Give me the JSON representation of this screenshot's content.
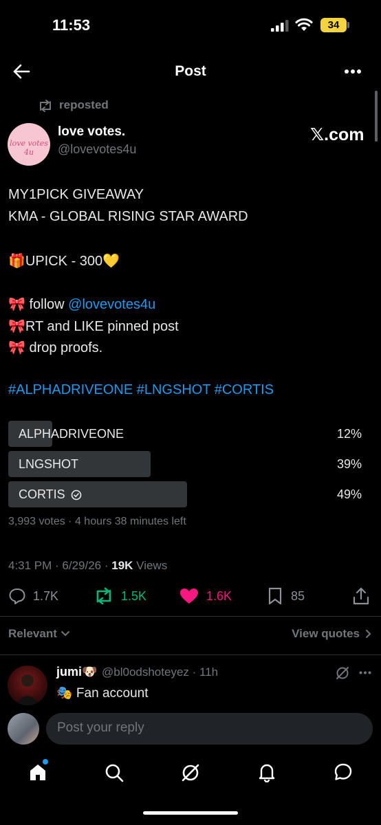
{
  "status_bar": {
    "time": "11:53",
    "battery": "34"
  },
  "header": {
    "title": "Post",
    "back_icon": "back-arrow-icon",
    "more_icon": "more-horizontal-icon"
  },
  "repost": {
    "label": "reposted"
  },
  "post": {
    "display_name": "love votes.",
    "handle": "@lovevotes4u",
    "avatar_text": "love votes 4u",
    "source_badge": "𝕏.com",
    "lines": {
      "l1": "MY1PICK GIVEAWAY",
      "l2": "KMA - GLOBAL RISING STAR AWARD",
      "l3": "🎁UPICK - 300💛",
      "l4_prefix": "🎀 follow ",
      "l4_mention": "@lovevotes4u",
      "l5": "🎀RT and LIKE pinned post",
      "l6": "🎀 drop proofs.",
      "hashtags": "#ALPHADRIVEONE #LNGSHOT #CORTIS"
    }
  },
  "poll": {
    "options": [
      {
        "label": "ALPHADRIVEONE",
        "percent_text": "12%",
        "percent": 12,
        "winner": false
      },
      {
        "label": "LNGSHOT",
        "percent_text": "39%",
        "percent": 39,
        "winner": false
      },
      {
        "label": "CORTIS",
        "percent_text": "49%",
        "percent": 49,
        "winner": true
      }
    ],
    "meta": "3,993 votes · 4 hours 38 minutes left"
  },
  "stats": {
    "time_date": "4:31 PM · 6/29/26 · ",
    "views_count": "19K",
    "views_label": " Views"
  },
  "actions": {
    "replies": "1.7K",
    "reposts": "1.5K",
    "likes": "1.6K",
    "bookmarks": "85",
    "colors": {
      "repost": "#00ba7c",
      "like": "#f91880",
      "link": "#1d9bf0"
    }
  },
  "replies_bar": {
    "sort_label": "Relevant",
    "view_quotes": "View quotes"
  },
  "reply": {
    "name": "jumi🐶",
    "handle_time": "@bl0odshoteyez · 11h",
    "text": "🎭 Fan account"
  },
  "composer": {
    "placeholder": "Post your reply"
  },
  "tabbar": {
    "items": [
      "home-icon",
      "search-icon",
      "grok-icon",
      "notifications-icon",
      "messages-icon"
    ]
  }
}
